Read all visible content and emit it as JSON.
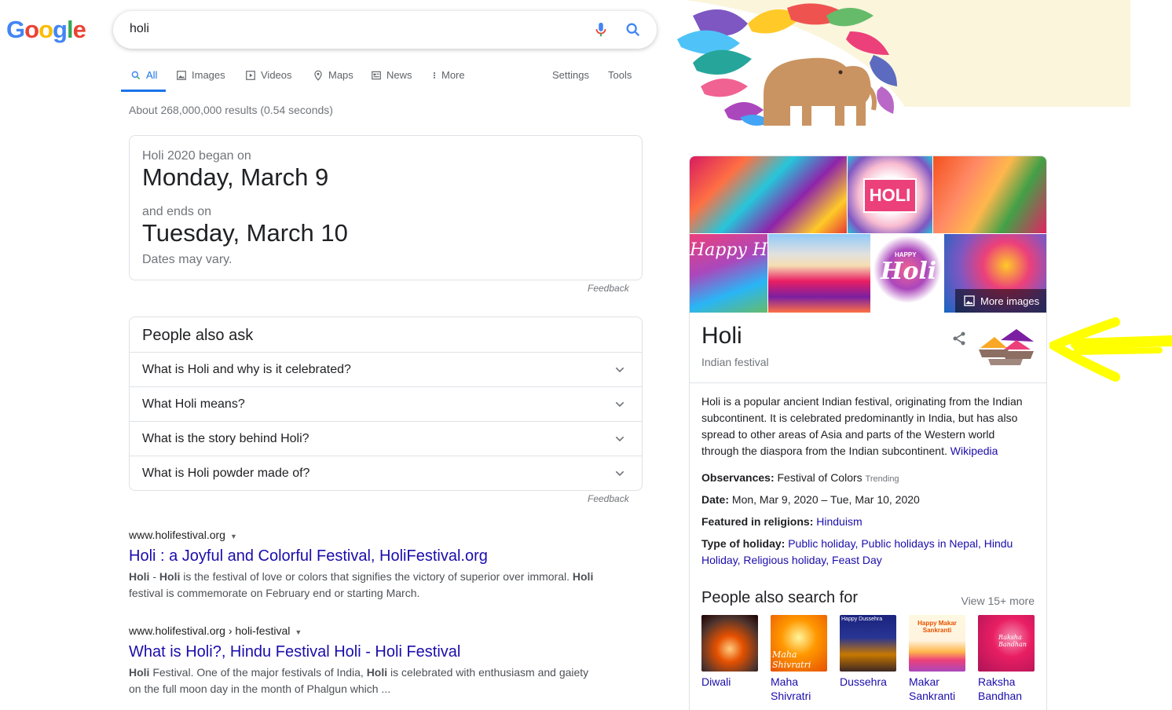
{
  "header": {
    "logo_letters": [
      {
        "ch": "G",
        "color": "#4285F4"
      },
      {
        "ch": "o",
        "color": "#EA4335"
      },
      {
        "ch": "o",
        "color": "#FBBC05"
      },
      {
        "ch": "g",
        "color": "#4285F4"
      },
      {
        "ch": "l",
        "color": "#34A853"
      },
      {
        "ch": "e",
        "color": "#EA4335"
      }
    ],
    "query": "holi"
  },
  "tabs": {
    "all": "All",
    "images": "Images",
    "videos": "Videos",
    "maps": "Maps",
    "news": "News",
    "more": "More",
    "settings": "Settings",
    "tools": "Tools"
  },
  "stats": "About 268,000,000 results (0.54 seconds)",
  "date_card": {
    "began_label": "Holi 2020 began on",
    "began_date": "Monday, March 9",
    "ends_label": "and ends on",
    "ends_date": "Tuesday, March 10",
    "note": "Dates may vary.",
    "feedback": "Feedback"
  },
  "paa": {
    "title": "People also ask",
    "questions": [
      "What is Holi and why is it celebrated?",
      "What Holi means?",
      "What is the story behind Holi?",
      "What is Holi powder made of?"
    ],
    "feedback": "Feedback"
  },
  "results": [
    {
      "url": "www.holifestival.org",
      "title": "Holi : a Joyful and Colorful Festival, HoliFestival.org",
      "snippet_html": "<b>Holi</b> - <b>Holi</b> is the festival of love or colors that signifies the victory of superior over immoral. <b>Holi</b> festival is commemorate on February end or starting March."
    },
    {
      "url": "www.holifestival.org › holi-festival",
      "title": "What is Holi?, Hindu Festival Holi - Holi Festival",
      "snippet_html": "<b>Holi</b> Festival. One of the major festivals of India, <b>Holi</b> is celebrated with enthusiasm and gaiety on the full moon day in the month of Phalgun which ..."
    }
  ],
  "kp": {
    "image_text_1": "HOLI",
    "image_text_2": "Happy Holi",
    "image_text_3": "Holi",
    "image_text_3_small": "HAPPY",
    "more_images": "More images",
    "title": "Holi",
    "subtitle": "Indian festival",
    "description": "Holi is a popular ancient Indian festival, originating from the Indian subcontinent. It is celebrated predominantly in India, but has also spread to other areas of Asia and parts of the Western world through the diaspora from the Indian subcontinent.",
    "wiki": "Wikipedia",
    "observances_label": "Observances:",
    "observances_value": "Festival of Colors",
    "trending": "Trending",
    "date_label": "Date:",
    "date_value": "Mon, Mar 9, 2020 – Tue, Mar 10, 2020",
    "religions_label": "Featured in religions:",
    "religions_value": "Hinduism",
    "holiday_label": "Type of holiday:",
    "holiday_value": "Public holiday, Public holidays in Nepal, Hindu Holiday, Religious holiday, Feast Day",
    "pasf_title": "People also search for",
    "pasf_more": "View 15+ more",
    "pasf": [
      "Diwali",
      "Maha Shivratri",
      "Dussehra",
      "Makar Sankranti",
      "Raksha Bandhan"
    ],
    "pasf_thumb_text": [
      "",
      "Maha Shivratri",
      "Happy Dussehra",
      "Happy Makar Sankranti",
      "Raksha Bandhan"
    ]
  },
  "colors": {
    "accent": "#1a73e8",
    "link": "#1a0dab",
    "annotation": "#ffff00"
  }
}
